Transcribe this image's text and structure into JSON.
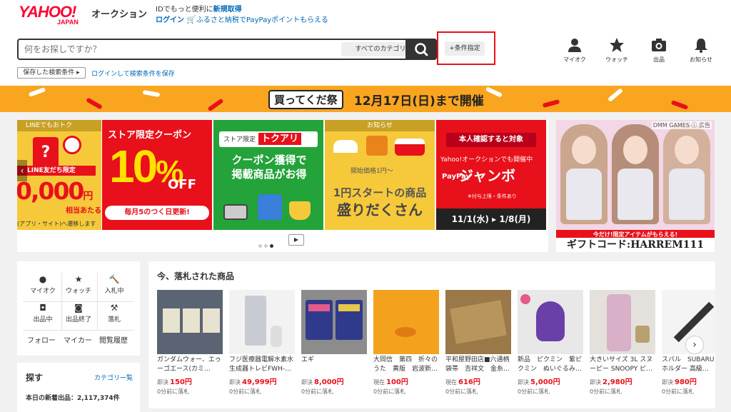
{
  "header": {
    "logo_main": "YAHOO!",
    "logo_sub": "JAPAN",
    "logo_auction": "オークション",
    "id_promo_text": "IDでもっと便利に",
    "id_promo_link": "新規取得",
    "login_link": "ログイン",
    "furusato_link": "ふるさと納税でPayPayポイントもらえる"
  },
  "search": {
    "placeholder": "何をお探しですか？",
    "category_button": "すべてのカテゴリ",
    "condition_button": "+条件指定",
    "saved_conditions": "保存した検索条件",
    "login_to_save": "ログインして検索条件を保存"
  },
  "top_icons": [
    {
      "icon": "person-icon",
      "label": "マイオク"
    },
    {
      "icon": "star-icon",
      "label": "ウォッチ"
    },
    {
      "icon": "camera-icon",
      "label": "出品"
    },
    {
      "icon": "bell-icon",
      "label": "お知らせ"
    }
  ],
  "banner": {
    "logo_text": "買ってくだ祭",
    "date_text": "12月17日(日)まで開催"
  },
  "carousel": {
    "slide1": {
      "header": "LINEでもおトク",
      "line_label": "LINE友だち限定",
      "amount": "0,000",
      "yen": "円",
      "sub": "相当あたる",
      "foot": "(アプリ・サイト)へ遷移します"
    },
    "slide2": {
      "title": "ストア限定クーポン",
      "percent": "10",
      "percent_sign": "%",
      "off": "OFF",
      "every": "毎月5のつく日更新!"
    },
    "slide3": {
      "store_label": "ストア限定",
      "tokuari": "トクアリ",
      "line1": "クーポン獲得で",
      "line2": "掲載商品がお得"
    },
    "slide4": {
      "header": "お知らせ",
      "price": "開始価格1円～",
      "line1": "1円スタートの商品",
      "line2": "盛りだくさん"
    },
    "slide5": {
      "header": "本人確認すると対象",
      "sub": "Yahoo!オークションでも開催中",
      "paypay": "PayPay",
      "jumbo": "ジャンボ",
      "note": "※付与上限・条件あり",
      "dates": "11/1(水) ▸ 1/8(月)"
    }
  },
  "ad": {
    "tag": "DMM GAMES ⓘ 広告",
    "promo": "今だけ!限定アイテムがもらえる!",
    "code": "ギフトコード:HARREM111"
  },
  "left_nav": {
    "items": [
      {
        "icon": "person-icon",
        "label": "マイオク"
      },
      {
        "icon": "star-icon",
        "label": "ウォッチ"
      },
      {
        "icon": "gavel-icon",
        "label": "入札中"
      },
      {
        "icon": "camera-icon",
        "label": "出品中"
      },
      {
        "icon": "camera-done-icon",
        "label": "出品終了"
      },
      {
        "icon": "gavel-won-icon",
        "label": "落札"
      }
    ],
    "follow": "フォロー",
    "mycar": "マイカー",
    "history": "閲覧履歴"
  },
  "search_box": {
    "title": "探す",
    "category_list": "カテゴリ一覧",
    "new_count": "本日の新着出品：2,117,374件"
  },
  "recent": {
    "title": "今、落札された商品",
    "items": [
      {
        "name": "ガンダムウォー、エゥーゴエース(カミ…",
        "price_type": "即決",
        "price": "150円",
        "ago": "0分前に落札"
      },
      {
        "name": "フジ医療器電解水素水生成器トレビFWH-…",
        "price_type": "即決",
        "price": "49,999円",
        "ago": "0分前に落札"
      },
      {
        "name": "エギ",
        "price_type": "即決",
        "price": "8,000円",
        "ago": "0分前に落札"
      },
      {
        "name": "大岡信　第四　折々のうた　黄版　岩波新…",
        "price_type": "現在",
        "price": "100円",
        "ago": "0分前に落札"
      },
      {
        "name": "平和屋野田店■六通柄袋帯　吉祥文　金糸…",
        "price_type": "現在",
        "price": "616円",
        "ago": "0分前に落札"
      },
      {
        "name": "新品　ピクミン　紫ピクミン　ぬいぐるみ…",
        "price_type": "即決",
        "price": "5,000円",
        "ago": "0分前に落札"
      },
      {
        "name": "大きいサイズ 3L スヌーピー SNOOPY ピ…",
        "price_type": "即決",
        "price": "2,980円",
        "ago": "0分前に落札"
      },
      {
        "name": "スバル　SUBARU ーホルダー 高級…",
        "price_type": "即決",
        "price": "980円",
        "ago": "0分前に落札"
      }
    ]
  }
}
